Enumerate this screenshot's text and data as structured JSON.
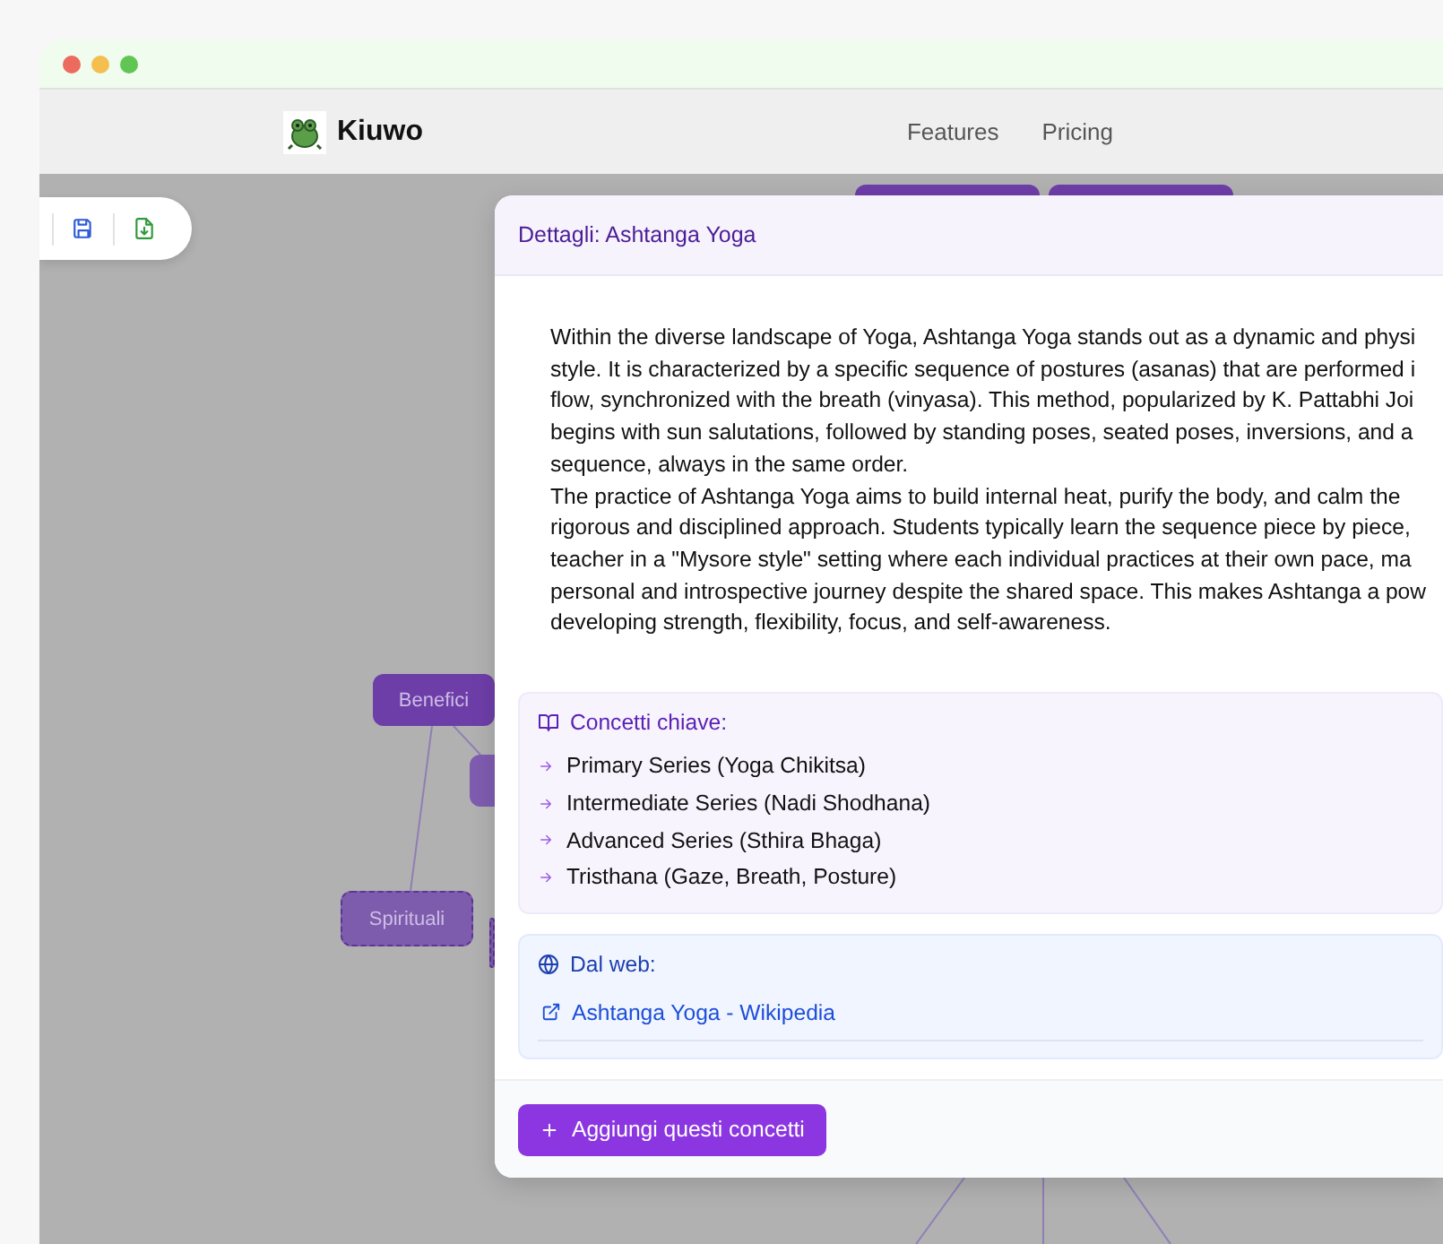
{
  "brand": {
    "name": "Kiuwo"
  },
  "nav": [
    "Features",
    "Pricing"
  ],
  "canvas": {
    "nodes": [
      {
        "kind": "solid"
      },
      {
        "kind": "solid"
      },
      {
        "kind": "solid",
        "label": "Benefici"
      },
      {
        "kind": "faded"
      },
      {
        "kind": "dashed",
        "label": "Spirituali"
      },
      {
        "kind": "dashed"
      }
    ]
  },
  "panel": {
    "title": "Dettagli: Ashtanga Yoga",
    "paragraphs": [
      [
        "Within the diverse landscape of Yoga, Ashtanga Yoga stands out as a dynamic and physi",
        "style. It is characterized by a specific sequence of postures (asanas) that are performed i",
        "flow, synchronized with the breath (vinyasa). This method, popularized by K. Pattabhi Joi",
        "begins with sun salutations, followed by standing poses, seated poses, inversions, and a",
        "sequence, always in the same order."
      ],
      [
        "The practice of Ashtanga Yoga aims to build internal heat, purify the body, and calm the",
        "rigorous and disciplined approach. Students typically learn the sequence piece by piece,",
        "teacher in a \"Mysore style\" setting where each individual practices at their own pace, ma",
        "personal and introspective journey despite the shared space. This makes Ashtanga a pow",
        "developing strength, flexibility, focus, and self-awareness."
      ]
    ],
    "concepts": {
      "heading": "Concetti chiave:",
      "items": [
        "Primary Series (Yoga Chikitsa)",
        "Intermediate Series (Nadi Shodhana)",
        "Advanced Series (Sthira Bhaga)",
        "Tristhana (Gaze, Breath, Posture)"
      ]
    },
    "web": {
      "heading": "Dal web:",
      "links": [
        "Ashtanga Yoga - Wikipedia"
      ]
    },
    "add_button": "Aggiungi questi concetti"
  }
}
